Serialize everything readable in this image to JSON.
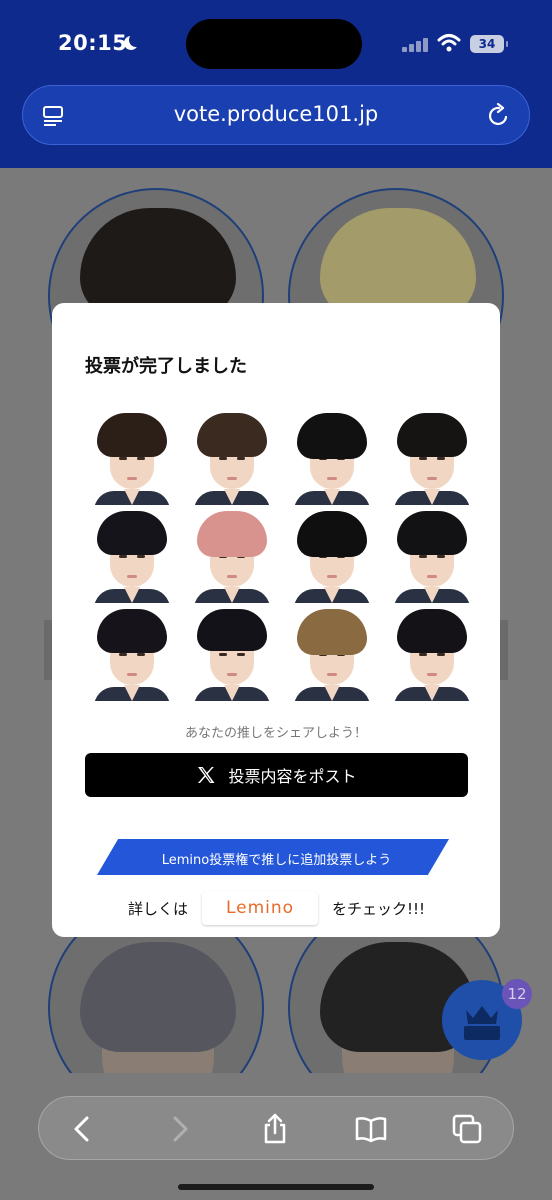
{
  "status_bar": {
    "time": "20:15",
    "battery": "34"
  },
  "browser": {
    "url": "vote.produce101.jp"
  },
  "modal": {
    "title": "投票が完了しました",
    "share_prompt": "あなたの推しをシェアしよう！",
    "post_button_label": "投票内容をポスト",
    "lemino_banner": "Lemino投票権で推しに追加投票しよう",
    "lemino_prefix": "詳しくは",
    "lemino_logo": "Lemino",
    "lemino_suffix": "をチェック!!!"
  },
  "vote_badge_count": "12",
  "colors": {
    "header_blue": "#0d2a8c",
    "lemino_blue": "#2356d9",
    "lemino_box": "#cfe1fb",
    "post_button": "#000000"
  }
}
